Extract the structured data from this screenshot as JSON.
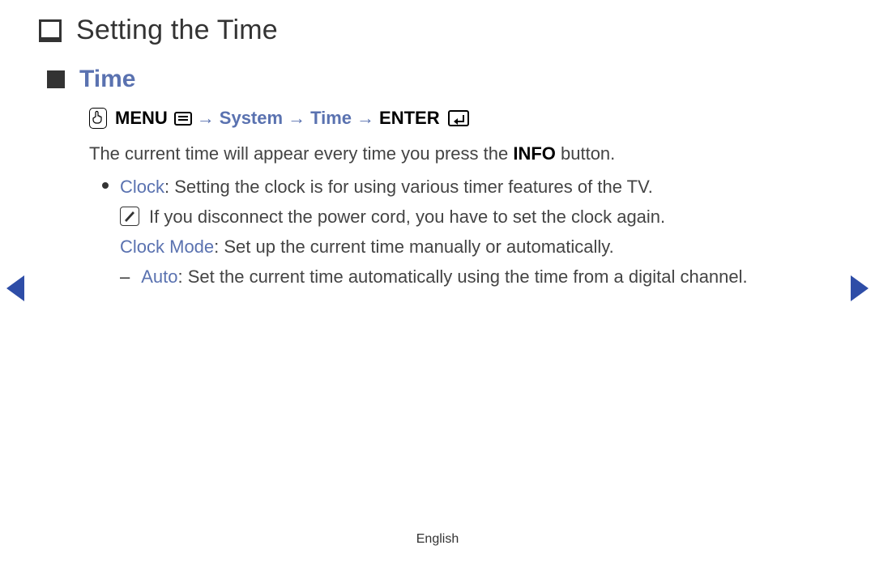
{
  "header": {
    "title": "Setting the Time"
  },
  "section": {
    "title": "Time"
  },
  "menupath": {
    "menu_label": "MENU",
    "arrow": "→",
    "steps": [
      "System",
      "Time"
    ],
    "enter_label": "ENTER"
  },
  "body": {
    "intro_pre": "The current time will appear every time you press the ",
    "intro_info": "INFO",
    "intro_post": " button.",
    "clock_term": "Clock",
    "clock_desc": ": Setting the clock is for using various timer features of the TV.",
    "note": "If you disconnect the power cord, you have to set the clock again.",
    "clockmode_term": "Clock Mode",
    "clockmode_desc": ": Set up the current time manually or automatically.",
    "auto_dash": "–",
    "auto_term": "Auto",
    "auto_desc": ": Set the current time automatically using the time from a digital channel."
  },
  "footer": {
    "language": "English"
  }
}
